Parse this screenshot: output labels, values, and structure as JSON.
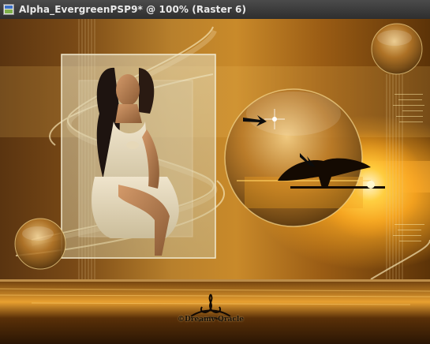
{
  "window": {
    "title": "Alpha_EvergreenPSP9* @ 100% (Raster 6)"
  },
  "icons": {
    "app": "psp-document-icon"
  },
  "colors": {
    "titlebar": "#2e2e2e",
    "title_text": "#eaeaea",
    "canvas_gold": "#c98a2a",
    "canvas_dark": "#5a3410"
  },
  "canvas": {
    "watermark_text": "©Dreamv Oracle"
  }
}
